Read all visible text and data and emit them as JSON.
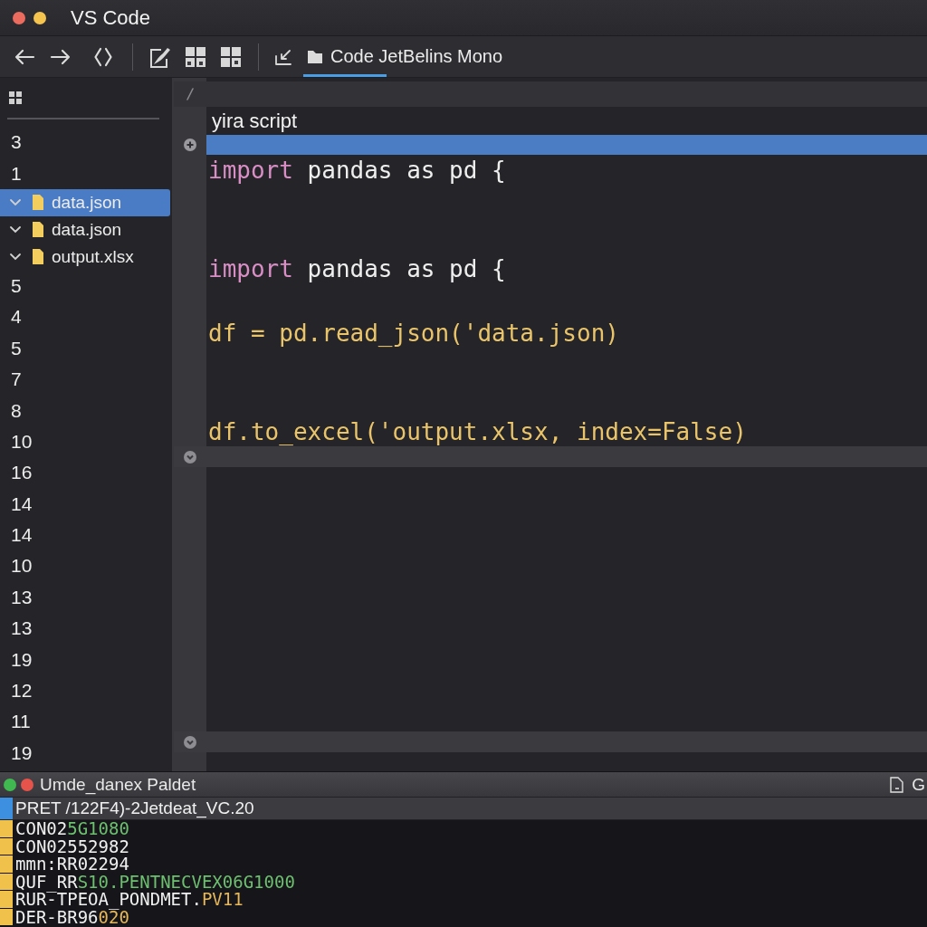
{
  "window": {
    "title": "VS Code",
    "controls": [
      {
        "color": "#ec6b5f"
      },
      {
        "color": "#f4c44f"
      }
    ]
  },
  "toolbar": {
    "tab": {
      "label": "Code JetBelins Mono",
      "selected": true
    }
  },
  "sidebar": {
    "items": [
      {
        "kind": "count",
        "label": "3",
        "selected": false
      },
      {
        "kind": "count",
        "label": "1",
        "selected": false
      },
      {
        "kind": "file",
        "label": "data.json",
        "expanded": true,
        "selected": true
      },
      {
        "kind": "file",
        "label": "data.json",
        "expanded": true,
        "selected": false
      },
      {
        "kind": "file",
        "label": "output.xlsx",
        "expanded": true,
        "selected": false
      },
      {
        "kind": "count",
        "label": "5",
        "selected": false
      },
      {
        "kind": "count",
        "label": "4",
        "selected": false
      },
      {
        "kind": "count",
        "label": "5",
        "selected": false
      },
      {
        "kind": "count",
        "label": "7",
        "selected": false
      },
      {
        "kind": "count",
        "label": "8",
        "selected": false
      },
      {
        "kind": "count",
        "label": "10",
        "selected": false
      },
      {
        "kind": "count",
        "label": "16",
        "selected": false
      },
      {
        "kind": "count",
        "label": "14",
        "selected": false
      },
      {
        "kind": "count",
        "label": "14",
        "selected": false
      },
      {
        "kind": "count",
        "label": "10",
        "selected": false
      },
      {
        "kind": "count",
        "label": "13",
        "selected": false
      },
      {
        "kind": "count",
        "label": "13",
        "selected": false
      },
      {
        "kind": "count",
        "label": "19",
        "selected": false
      },
      {
        "kind": "count",
        "label": "12",
        "selected": false
      },
      {
        "kind": "count",
        "label": "11",
        "selected": false
      },
      {
        "kind": "count",
        "label": "19",
        "selected": false
      }
    ]
  },
  "editor": {
    "lines": [
      {
        "kind": "strip"
      },
      {
        "kind": "title",
        "text": "yira script"
      },
      {
        "kind": "highlight"
      },
      {
        "kind": "code",
        "tokens": [
          {
            "kind": "keyword",
            "text": "import"
          },
          {
            "kind": "name",
            "text": " pandas as pd {"
          }
        ]
      },
      {
        "kind": "blank"
      },
      {
        "kind": "blank"
      },
      {
        "kind": "code",
        "tokens": [
          {
            "kind": "keyword",
            "text": "import"
          },
          {
            "kind": "name",
            "text": " pandas as pd {"
          }
        ]
      },
      {
        "kind": "blank"
      },
      {
        "kind": "code",
        "tokens": [
          {
            "kind": "expression",
            "text": "df = pd.read_json('data.json)"
          }
        ]
      },
      {
        "kind": "blank"
      },
      {
        "kind": "blank"
      },
      {
        "kind": "code",
        "tokens": [
          {
            "kind": "expression",
            "text": "df.to_excel('output.xlsx, index=False)"
          }
        ]
      },
      {
        "kind": "fold"
      },
      {
        "kind": "fold"
      }
    ]
  },
  "panel": {
    "title": "Umde_danex Paldet",
    "dots": [
      {
        "color": "#3fb950"
      },
      {
        "color": "#e5534b"
      }
    ],
    "corner_label": "G"
  },
  "terminal": {
    "lines": [
      {
        "kind": "header",
        "color": "#3d8fe0",
        "segments": [
          {
            "kind": "plain",
            "text": "PRET /122F4)-2Jetdeat_VC.20"
          }
        ]
      },
      {
        "kind": "output",
        "color": "#f0c24b",
        "segments": [
          {
            "kind": "plain",
            "text": "CON02"
          },
          {
            "kind": "ok",
            "text": "5G1080"
          }
        ]
      },
      {
        "kind": "output",
        "color": "#f0c24b",
        "segments": [
          {
            "kind": "plain",
            "text": "CON02552982"
          }
        ]
      },
      {
        "kind": "output",
        "color": "#f0c24b",
        "segments": [
          {
            "kind": "plain",
            "text": "mmn:RR02294"
          }
        ]
      },
      {
        "kind": "output",
        "color": "#f0c24b",
        "segments": [
          {
            "kind": "plain",
            "text": "QUF_RR"
          },
          {
            "kind": "ok",
            "text": "S10.PENTNECVEX06G1000"
          }
        ]
      },
      {
        "kind": "output",
        "color": "#f0c24b",
        "segments": [
          {
            "kind": "plain",
            "text": "RUR-TPEOA_PONDMET."
          },
          {
            "kind": "warn",
            "text": "PV11"
          }
        ]
      },
      {
        "kind": "output",
        "color": "#f0c24b",
        "segments": [
          {
            "kind": "plain",
            "text": "DER-BR96"
          },
          {
            "kind": "warn",
            "text": "020"
          }
        ]
      }
    ]
  }
}
